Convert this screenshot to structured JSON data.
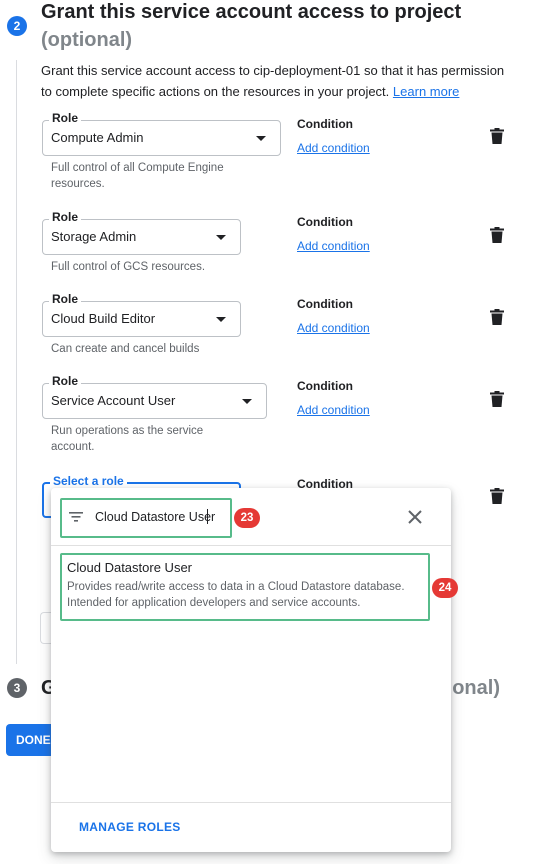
{
  "step2": {
    "number": "2",
    "title": "Grant this service account access to project",
    "optional": "(optional)",
    "description": "Grant this service account access to cip-deployment-01 so that it has permission to complete specific actions on the resources in your project.",
    "learn_more": "Learn more"
  },
  "roles": [
    {
      "label": "Role",
      "value": "Compute Admin",
      "hint_line1": "Full control of all Compute Engine",
      "hint_line2": "resources.",
      "condition_label": "Condition",
      "add_condition": "Add condition"
    },
    {
      "label": "Role",
      "value": "Storage Admin",
      "hint_line1": "Full control of GCS resources.",
      "hint_line2": "",
      "condition_label": "Condition",
      "add_condition": "Add condition"
    },
    {
      "label": "Role",
      "value": "Cloud Build Editor",
      "hint_line1": "Can create and cancel builds",
      "hint_line2": "",
      "condition_label": "Condition",
      "add_condition": "Add condition"
    },
    {
      "label": "Role",
      "value": "Service Account User",
      "hint_line1": "Run operations as the service",
      "hint_line2": "account.",
      "condition_label": "Condition",
      "add_condition": "Add condition"
    }
  ],
  "new_role": {
    "label": "Select a role",
    "condition_label": "Condition"
  },
  "step3": {
    "number": "3",
    "title_start": "G",
    "title_end": "tional)"
  },
  "done_button": "DONE",
  "dropdown": {
    "filter_value": "Cloud Datastore User",
    "result_title": "Cloud Datastore User",
    "result_desc_line1": "Provides read/write access to data in a Cloud Datastore database.",
    "result_desc_line2": "Intended for application developers and service accounts.",
    "manage_roles": "MANAGE ROLES"
  },
  "annotations": {
    "filter": "23",
    "result": "24"
  },
  "colors": {
    "accent": "#1a73e8",
    "highlight": "#57bb8a",
    "annotation": "#e53935"
  }
}
